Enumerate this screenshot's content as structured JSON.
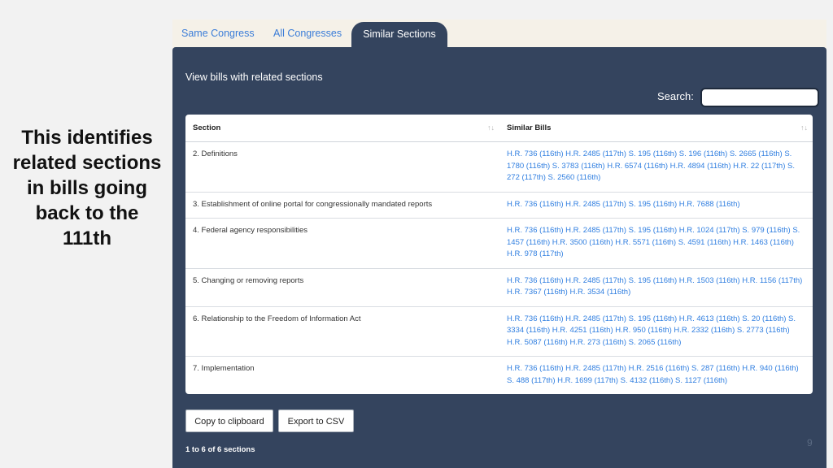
{
  "caption": "This identifies related sections in bills going back to the 111th",
  "tabs": [
    {
      "label": "Same Congress"
    },
    {
      "label": "All Congresses"
    },
    {
      "label": "Similar Sections"
    }
  ],
  "panel": {
    "heading": "View bills with related sections",
    "search_label": "Search:",
    "search_value": ""
  },
  "table": {
    "headers": {
      "section": "Section",
      "similar_bills": "Similar Bills"
    },
    "sort_icon": "↑↓",
    "rows": [
      {
        "section": "2. Definitions",
        "bills": "H.R. 736 (116th) H.R. 2485 (117th) S. 195 (116th) S. 196 (116th) S. 2665 (116th) S. 1780 (116th) S. 3783 (116th) H.R. 6574 (116th) H.R. 4894 (116th) H.R. 22 (117th) S. 272 (117th) S. 2560 (116th)"
      },
      {
        "section": "3. Establishment of online portal for congressionally mandated reports",
        "bills": "H.R. 736 (116th) H.R. 2485 (117th) S. 195 (116th) H.R. 7688 (116th)"
      },
      {
        "section": "4. Federal agency responsibilities",
        "bills": "H.R. 736 (116th) H.R. 2485 (117th) S. 195 (116th) H.R. 1024 (117th) S. 979 (116th) S. 1457 (116th) H.R. 3500 (116th) H.R. 5571 (116th) S. 4591 (116th) H.R. 1463 (116th) H.R. 978 (117th)"
      },
      {
        "section": "5. Changing or removing reports",
        "bills": "H.R. 736 (116th) H.R. 2485 (117th) S. 195 (116th) H.R. 1503 (116th) H.R. 1156 (117th) H.R. 7367 (116th) H.R. 3534 (116th)"
      },
      {
        "section": "6. Relationship to the Freedom of Information Act",
        "bills": "H.R. 736 (116th) H.R. 2485 (117th) S. 195 (116th) H.R. 4613 (116th) S. 20 (116th) S. 3334 (116th) H.R. 4251 (116th) H.R. 950 (116th) H.R. 2332 (116th) S. 2773 (116th) H.R. 5087 (116th) H.R. 273 (116th) S. 2065 (116th)"
      },
      {
        "section": "7. Implementation",
        "bills": "H.R. 736 (116th) H.R. 2485 (117th) H.R. 2516 (116th) S. 287 (116th) H.R. 940 (116th) S. 488 (117th) H.R. 1699 (117th) S. 4132 (116th) S. 1127 (116th)"
      }
    ]
  },
  "buttons": {
    "copy": "Copy to clipboard",
    "export": "Export to CSV"
  },
  "footer": {
    "count": "1 to 6 of 6 sections"
  },
  "page_number": "9"
}
